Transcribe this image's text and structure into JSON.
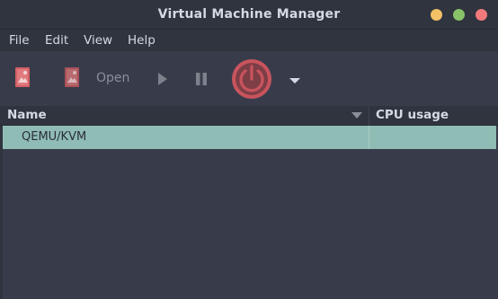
{
  "window": {
    "title": "Virtual Machine Manager",
    "controls": {
      "minimize_color": "#f3c267",
      "maximize_color": "#89c269",
      "close_color": "#f17a7a"
    }
  },
  "menubar": {
    "items": [
      "File",
      "Edit",
      "View",
      "Help"
    ]
  },
  "toolbar": {
    "open_label": "Open",
    "icons": [
      "new-vm-icon",
      "open-icon",
      "run-icon",
      "pause-icon",
      "shutdown-icon",
      "dropdown-arrow-icon"
    ],
    "power_color": "#c9545e"
  },
  "table": {
    "columns": [
      "Name",
      "CPU usage"
    ],
    "rows": [
      {
        "name": "QEMU/KVM",
        "cpu_usage": ""
      }
    ],
    "selected_row_color": "#8fbcb4"
  }
}
